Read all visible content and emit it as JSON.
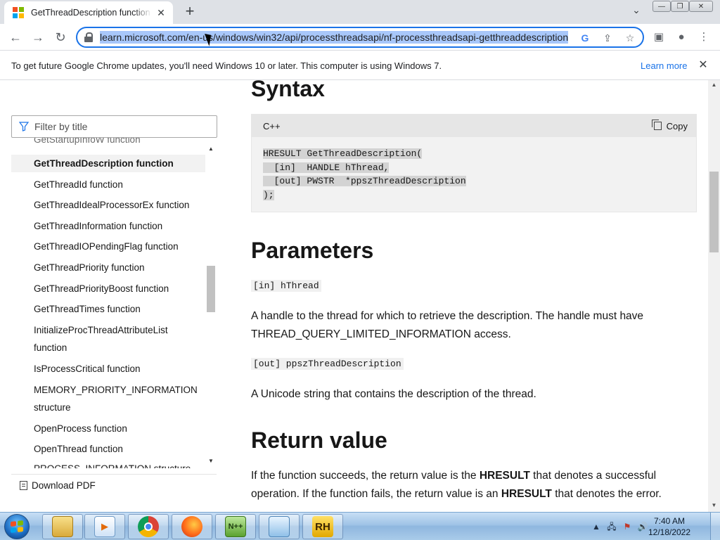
{
  "browser": {
    "tab_title": "GetThreadDescription function (processthreadsapi.h)",
    "tab_close": "✕",
    "new_tab": "+",
    "url": "learn.microsoft.com/en-us/windows/win32/api/processthreadsapi/nf-processthreadsapi-getthreaddescription",
    "window_controls": {
      "minimize": "—",
      "restore": "❐",
      "close": "✕"
    }
  },
  "infobar": {
    "message": "To get future Google Chrome updates, you'll need Windows 10 or later. This computer is using Windows 7.",
    "link": "Learn more",
    "close": "✕"
  },
  "sidebar": {
    "filter_placeholder": "Filter by title",
    "items": [
      {
        "label": "GetStartupInfoW function",
        "selected": false
      },
      {
        "label": "GetThreadDescription function",
        "selected": true
      },
      {
        "label": "GetThreadId function",
        "selected": false
      },
      {
        "label": "GetThreadIdealProcessorEx function",
        "selected": false
      },
      {
        "label": "GetThreadInformation function",
        "selected": false
      },
      {
        "label": "GetThreadIOPendingFlag function",
        "selected": false
      },
      {
        "label": "GetThreadPriority function",
        "selected": false
      },
      {
        "label": "GetThreadPriorityBoost function",
        "selected": false
      },
      {
        "label": "GetThreadTimes function",
        "selected": false
      },
      {
        "label": "InitializeProcThreadAttributeList",
        "selected": false
      },
      {
        "label": "function",
        "selected": false
      },
      {
        "label": "IsProcessCritical function",
        "selected": false
      },
      {
        "label": "MEMORY_PRIORITY_INFORMATION",
        "selected": false
      },
      {
        "label": "structure",
        "selected": false
      },
      {
        "label": "OpenProcess function",
        "selected": false
      },
      {
        "label": "OpenThread function",
        "selected": false
      },
      {
        "label": "PROCESS_INFORMATION structure",
        "selected": false
      }
    ],
    "download_pdf": "Download PDF"
  },
  "article": {
    "syntax_heading": "Syntax",
    "code_lang": "C++",
    "copy_label": "Copy",
    "code_lines": [
      "HRESULT GetThreadDescription(",
      "  [in]  HANDLE hThread,",
      "  [out] PWSTR  *ppszThreadDescription",
      ");"
    ],
    "parameters_heading": "Parameters",
    "param1_name": "[in] hThread",
    "param1_desc_1": "A handle to the thread for which to retrieve the description. The handle must have",
    "param1_desc_2": "THREAD_QUERY_LIMITED_INFORMATION access.",
    "param2_name": "[out] ppszThreadDescription",
    "param2_desc": "A Unicode string that contains the description of the thread.",
    "return_heading": "Return value",
    "return_p1_a": "If the function succeeds, the return value is the ",
    "return_p1_b": "HRESULT",
    "return_p1_c": " that denotes a successful",
    "return_p2_a": "operation. If the function fails, the return value is an ",
    "return_p2_b": "HRESULT",
    "return_p2_c": " that denotes the error."
  },
  "taskbar": {
    "clock_time": "7:40 AM",
    "clock_date": "12/18/2022",
    "apps": [
      "explorer-icon",
      "media-player-icon",
      "chrome-icon",
      "firefox-icon",
      "notepadpp-icon",
      "notepad-icon",
      "rh-icon"
    ],
    "rh_label": "RH"
  },
  "colors": {
    "accent": "#1a73e8",
    "url_highlight": "#a8c7fa",
    "selected_item": "#f2f2f2"
  }
}
